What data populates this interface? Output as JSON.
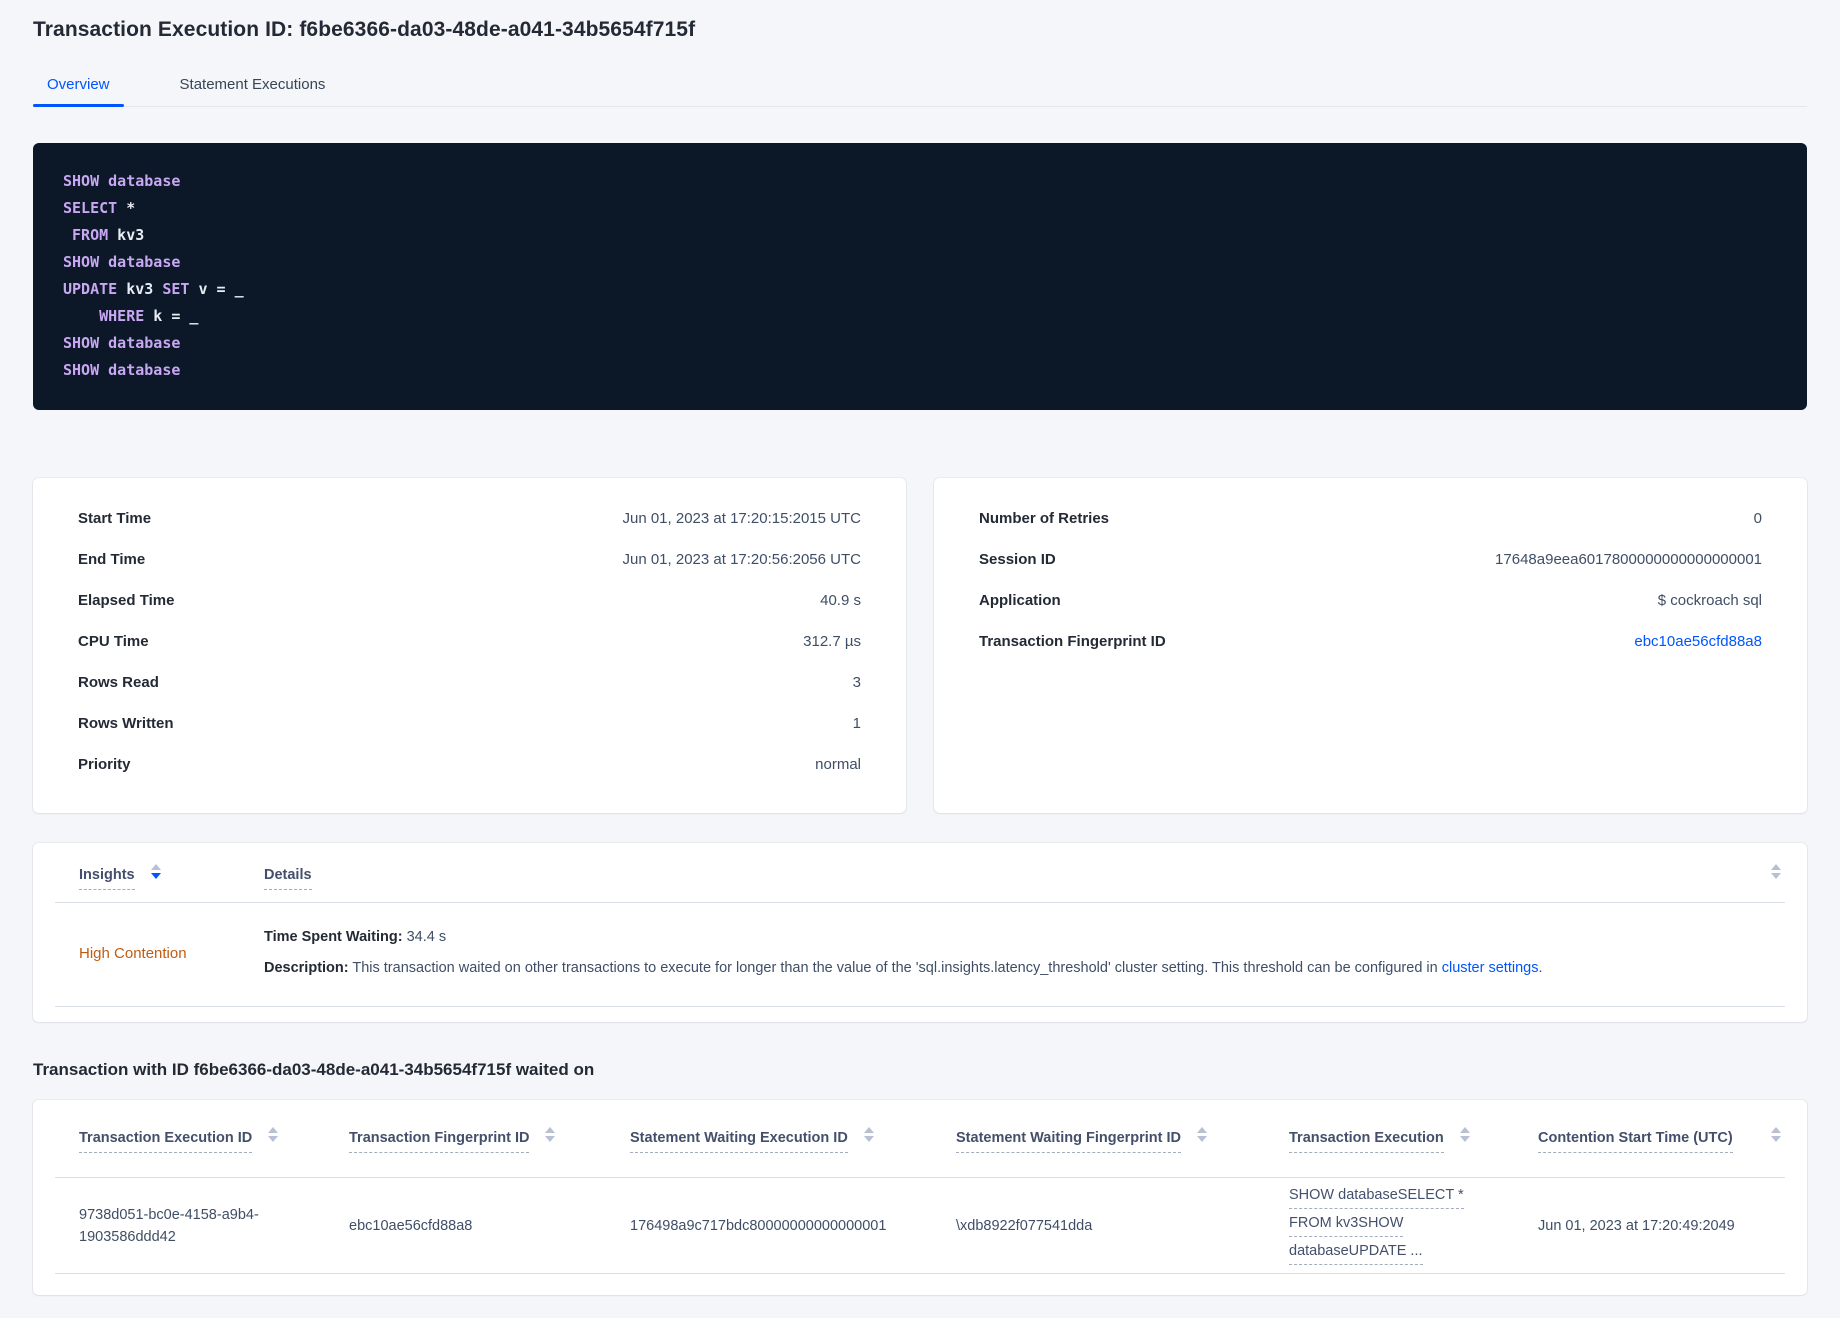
{
  "header": {
    "title": "Transaction Execution ID: f6be6366-da03-48de-a041-34b5654f715f"
  },
  "tabs": [
    {
      "label": "Overview",
      "active": true
    },
    {
      "label": "Statement Executions",
      "active": false
    }
  ],
  "sql": {
    "lines": [
      [
        {
          "c": "kw",
          "t": "SHOW database"
        }
      ],
      [
        {
          "c": "kw",
          "t": "SELECT"
        },
        {
          "c": "id",
          "t": " *"
        }
      ],
      [
        {
          "c": "kw",
          "t": " FROM"
        },
        {
          "c": "id",
          "t": " kv3"
        }
      ],
      [
        {
          "c": "kw",
          "t": "SHOW database"
        }
      ],
      [
        {
          "c": "kw",
          "t": "UPDATE"
        },
        {
          "c": "id",
          "t": " kv3 "
        },
        {
          "c": "kw",
          "t": "SET"
        },
        {
          "c": "id",
          "t": " v = _"
        }
      ],
      [
        {
          "c": "kw",
          "t": "    WHERE"
        },
        {
          "c": "id",
          "t": " k = _"
        }
      ],
      [
        {
          "c": "kw",
          "t": "SHOW database"
        }
      ],
      [
        {
          "c": "kw",
          "t": "SHOW database"
        }
      ]
    ]
  },
  "summary_card": {
    "rows": [
      {
        "label": "Start Time",
        "value": "Jun 01, 2023 at 17:20:15:2015 UTC"
      },
      {
        "label": "End Time",
        "value": "Jun 01, 2023 at 17:20:56:2056 UTC"
      },
      {
        "label": "Elapsed Time",
        "value": "40.9 s"
      },
      {
        "label": "CPU Time",
        "value": "312.7 µs"
      },
      {
        "label": "Rows Read",
        "value": "3"
      },
      {
        "label": "Rows Written",
        "value": "1"
      },
      {
        "label": "Priority",
        "value": "normal"
      }
    ]
  },
  "meta_card": {
    "rows": [
      {
        "label": "Number of Retries",
        "value": "0"
      },
      {
        "label": "Session ID",
        "value": "17648a9eea6017800000000000000001"
      },
      {
        "label": "Application",
        "value": "$ cockroach sql"
      },
      {
        "label": "Transaction Fingerprint ID",
        "value": "ebc10ae56cfd88a8",
        "link": true
      }
    ]
  },
  "insights": {
    "columns": [
      {
        "label": "Insights"
      },
      {
        "label": "Details"
      }
    ],
    "row": {
      "insight": "High Contention",
      "time_label": "Time Spent Waiting:",
      "time_value": " 34.4 s",
      "desc_label": "Description:",
      "desc_text": " This transaction waited on other transactions to execute for longer than the value of the 'sql.insights.latency_threshold' cluster setting. This threshold can be configured in ",
      "desc_link": "cluster settings",
      "desc_suffix": "."
    }
  },
  "waited_on": {
    "heading": "Transaction with ID f6be6366-da03-48de-a041-34b5654f715f waited on",
    "columns": [
      "Transaction Execution ID",
      "Transaction Fingerprint ID",
      "Statement Waiting Execution ID",
      "Statement Waiting Fingerprint ID",
      "Transaction Execution",
      "Contention Start Time (UTC)"
    ],
    "row": {
      "transaction_execution_id": "9738d051-bc0e-4158-a9b4-1903586ddd42",
      "transaction_fingerprint_id": "ebc10ae56cfd88a8",
      "statement_waiting_execution_id": "176498a9c717bdc80000000000000001",
      "statement_waiting_fingerprint_id": "\\xdb8922f077541dda",
      "transaction_execution_lines": [
        "SHOW databaseSELECT *",
        "FROM kv3SHOW",
        "databaseUPDATE ..."
      ],
      "contention_start_time": "Jun 01, 2023 at 17:20:49:2049"
    }
  },
  "colors": {
    "accent_blue": "#0055ff",
    "insight_orange": "#c05c11",
    "code_background": "#0c1828",
    "code_keyword": "#c8a7f3",
    "code_text": "#e8edf4"
  }
}
